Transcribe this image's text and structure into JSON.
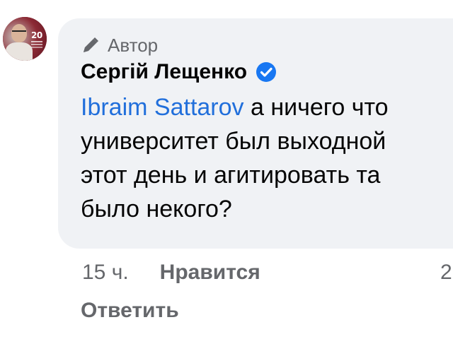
{
  "avatar": {
    "badge_number": "20"
  },
  "comment": {
    "author_label": "Автор",
    "author_name": "Сергій Лещенко",
    "mention": "Ibraim Sattarov",
    "line1_rest": " а ничего что",
    "line2": "университет был выходной",
    "line3": "этот день и агитировать та",
    "line4": "было некого?"
  },
  "actions": {
    "time": "15 ч.",
    "like_label": "Нравится",
    "reaction_count": "2",
    "reply_label": "Ответить"
  },
  "colors": {
    "bubble_bg": "#f0f2f5",
    "mention": "#216fdb",
    "verified": "#1877f2",
    "secondary_text": "#65676b",
    "primary_text": "#050505"
  },
  "icons": {
    "author_icon": "pen-icon",
    "verified_icon": "verified-badge-icon"
  }
}
